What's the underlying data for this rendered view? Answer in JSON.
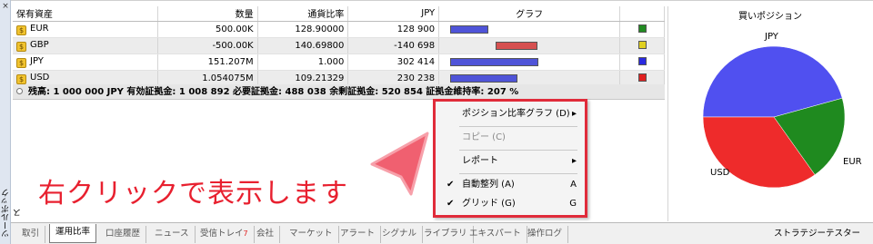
{
  "sidebar": {
    "close_glyph": "×",
    "title": "ツールボックス"
  },
  "table": {
    "headers": {
      "name": "保有資産",
      "volume": "数量",
      "rate": "通貨比率",
      "jpy": "JPY",
      "graph": "グラフ"
    },
    "rows": [
      {
        "coin": "$",
        "name": "EUR",
        "volume": "500.00K",
        "rate": "128.90000",
        "jpy": "128 900",
        "bar_fraction": 0.22,
        "bar_sign": "pos",
        "color": "#228b22"
      },
      {
        "coin": "$",
        "name": "GBP",
        "volume": "-500.00K",
        "rate": "140.69800",
        "jpy": "-140 698",
        "bar_fraction": 0.24,
        "bar_sign": "neg",
        "color": "#e0d020"
      },
      {
        "coin": "$",
        "name": "JPY",
        "volume": "151.207M",
        "rate": "1.000",
        "jpy": "302 414",
        "bar_fraction": 0.51,
        "bar_sign": "pos",
        "color": "#2a2ae0"
      },
      {
        "coin": "$",
        "name": "USD",
        "volume": "1.054075M",
        "rate": "109.21329",
        "jpy": "230 238",
        "bar_fraction": 0.39,
        "bar_sign": "pos",
        "color": "#e02020"
      }
    ]
  },
  "summary": "残高: 1 000 000 JPY  有効証拠金: 1 008 892  必要証拠金: 488 038  余剰証拠金: 520 854  証拠金維持率: 207 %",
  "pie": {
    "title": "買いポジション",
    "slices": [
      {
        "name": "JPY",
        "value": 302414,
        "color": "#5050f0"
      },
      {
        "name": "EUR",
        "value": 128900,
        "color": "#1f8a1f"
      },
      {
        "name": "USD",
        "value": 230238,
        "color": "#ee2b2b"
      }
    ]
  },
  "callout": "右クリックで表示します",
  "context_menu": {
    "items": [
      {
        "label": "ポジション比率グラフ (D)",
        "submenu": "▸",
        "enabled": true
      },
      {
        "label": "コピー (C)",
        "enabled": false
      },
      {
        "label": "レポート",
        "submenu": "▸",
        "enabled": true
      },
      {
        "label": "自動整列 (A)",
        "checked": "✔",
        "shortcut": "A",
        "enabled": true
      },
      {
        "label": "グリッド (G)",
        "checked": "✔",
        "shortcut": "G",
        "enabled": true
      }
    ]
  },
  "tabs": [
    {
      "label": "取引"
    },
    {
      "label": "運用比率",
      "active": true
    },
    {
      "label": "口座履歴"
    },
    {
      "label": "ニュース"
    },
    {
      "label": "受信トレイ",
      "badge": "7"
    },
    {
      "label": "会社"
    },
    {
      "label": "マーケット"
    },
    {
      "label": "アラート"
    },
    {
      "label": "シグナル"
    },
    {
      "label": "ライブラリ"
    },
    {
      "label": "エキスパート"
    },
    {
      "label": "操作ログ"
    }
  ],
  "tab_right": "ストラテジーテスター",
  "colors": {
    "accent_red": "#e02b3a",
    "bar_positive": "#4f54d8",
    "bar_negative": "#d65050"
  }
}
